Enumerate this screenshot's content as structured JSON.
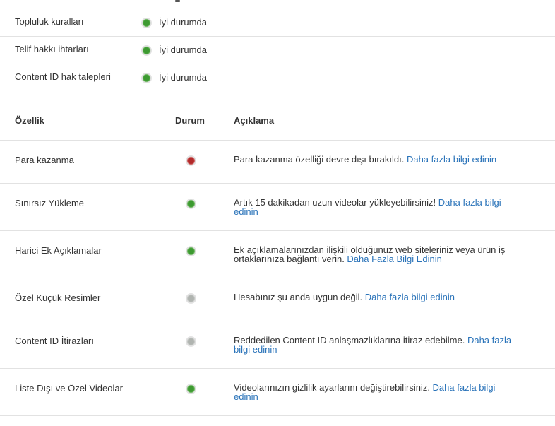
{
  "status_items": [
    {
      "label": "Topluluk kuralları",
      "state": "İyi durumda",
      "status": "green"
    },
    {
      "label": "Telif hakkı ihtarları",
      "state": "İyi durumda",
      "status": "green"
    },
    {
      "label": "Content ID hak talepleri",
      "state": "İyi durumda",
      "status": "green"
    }
  ],
  "table": {
    "headers": {
      "feature": "Özellik",
      "status": "Durum",
      "description": "Açıklama"
    },
    "rows": [
      {
        "name": "Para kazanma",
        "status": "red",
        "desc": "Para kazanma özelliği devre dışı bırakıldı. ",
        "link": "Daha fazla bilgi edinin"
      },
      {
        "name": "Sınırsız Yükleme",
        "status": "green",
        "desc": "Artık 15 dakikadan uzun videolar yükleyebilirsiniz! ",
        "link": "Daha fazla bilgi edinin"
      },
      {
        "name": "Harici Ek Açıklamalar",
        "status": "green",
        "desc": "Ek açıklamalarınızdan ilişkili olduğunuz web siteleriniz veya ürün iş ortaklarınıza bağlantı verin. ",
        "link": "Daha Fazla Bilgi Edinin"
      },
      {
        "name": "Özel Küçük Resimler",
        "status": "grey",
        "desc": "Hesabınız şu anda uygun değil. ",
        "link": "Daha fazla bilgi edinin"
      },
      {
        "name": "Content ID İtirazları",
        "status": "grey",
        "desc": "Reddedilen Content ID anlaşmazlıklarına itiraz edebilme. ",
        "link": "Daha fazla bilgi edinin"
      },
      {
        "name": "Liste Dışı ve Özel Videolar",
        "status": "green",
        "desc": "Videolarınızın gizlilik ayarlarını değiştirebilirsiniz. ",
        "link": "Daha fazla bilgi edinin"
      }
    ]
  },
  "colors": {
    "green": "#3d9a31",
    "red": "#b22a2a",
    "grey": "#b0b4b0",
    "link": "#2a73b9"
  }
}
